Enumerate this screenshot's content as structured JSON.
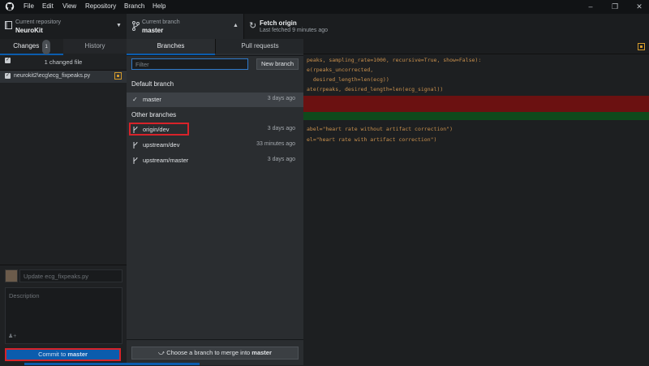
{
  "menu": {
    "items": [
      "File",
      "Edit",
      "View",
      "Repository",
      "Branch",
      "Help"
    ]
  },
  "toolbar": {
    "repo_label": "Current repository",
    "repo_name": "NeuroKit",
    "branch_label": "Current branch",
    "branch_name": "master",
    "fetch_title": "Fetch origin",
    "fetch_sub": "Last fetched 9 minutes ago"
  },
  "left": {
    "tab_changes": "Changes",
    "changes_count": "1",
    "tab_history": "History",
    "changed_files_label": "1 changed file",
    "file_path": "neurokit2\\ecg\\ecg_fixpeaks.py",
    "summary_placeholder": "Update ecg_fixpeaks.py",
    "description_placeholder": "Description",
    "commit_prefix": "Commit to ",
    "commit_branch": "master"
  },
  "dropdown": {
    "tab_branches": "Branches",
    "tab_pull_requests": "Pull requests",
    "filter_placeholder": "Filter",
    "new_branch": "New branch",
    "default_header": "Default branch",
    "default_branch": {
      "name": "master",
      "time": "3 days ago"
    },
    "other_header": "Other branches",
    "other_branches": [
      {
        "name": "origin/dev",
        "time": "3 days ago"
      },
      {
        "name": "upstream/dev",
        "time": "33 minutes ago"
      },
      {
        "name": "upstream/master",
        "time": "3 days ago"
      }
    ],
    "merge_prefix": "Choose a branch to merge into ",
    "merge_branch": "master"
  },
  "code": {
    "lines": [
      "peaks, sampling_rate=1000, recursive=True, show=False):",
      "e(rpeaks_uncorrected,",
      "  desired_length=len(ecg))",
      "ate(rpeaks, desired_length=len(ecg_signal))",
      "",
      "",
      "",
      "abel=\"heart rate without artifact correction\")",
      "el=\"heart rate with artifact correction\")"
    ]
  },
  "colors": {
    "accent": "#0b5cad",
    "highlight_red": "#d8232a",
    "deleted": "#6b1111",
    "added": "#0f4a1c",
    "warning": "#d39b2d"
  }
}
